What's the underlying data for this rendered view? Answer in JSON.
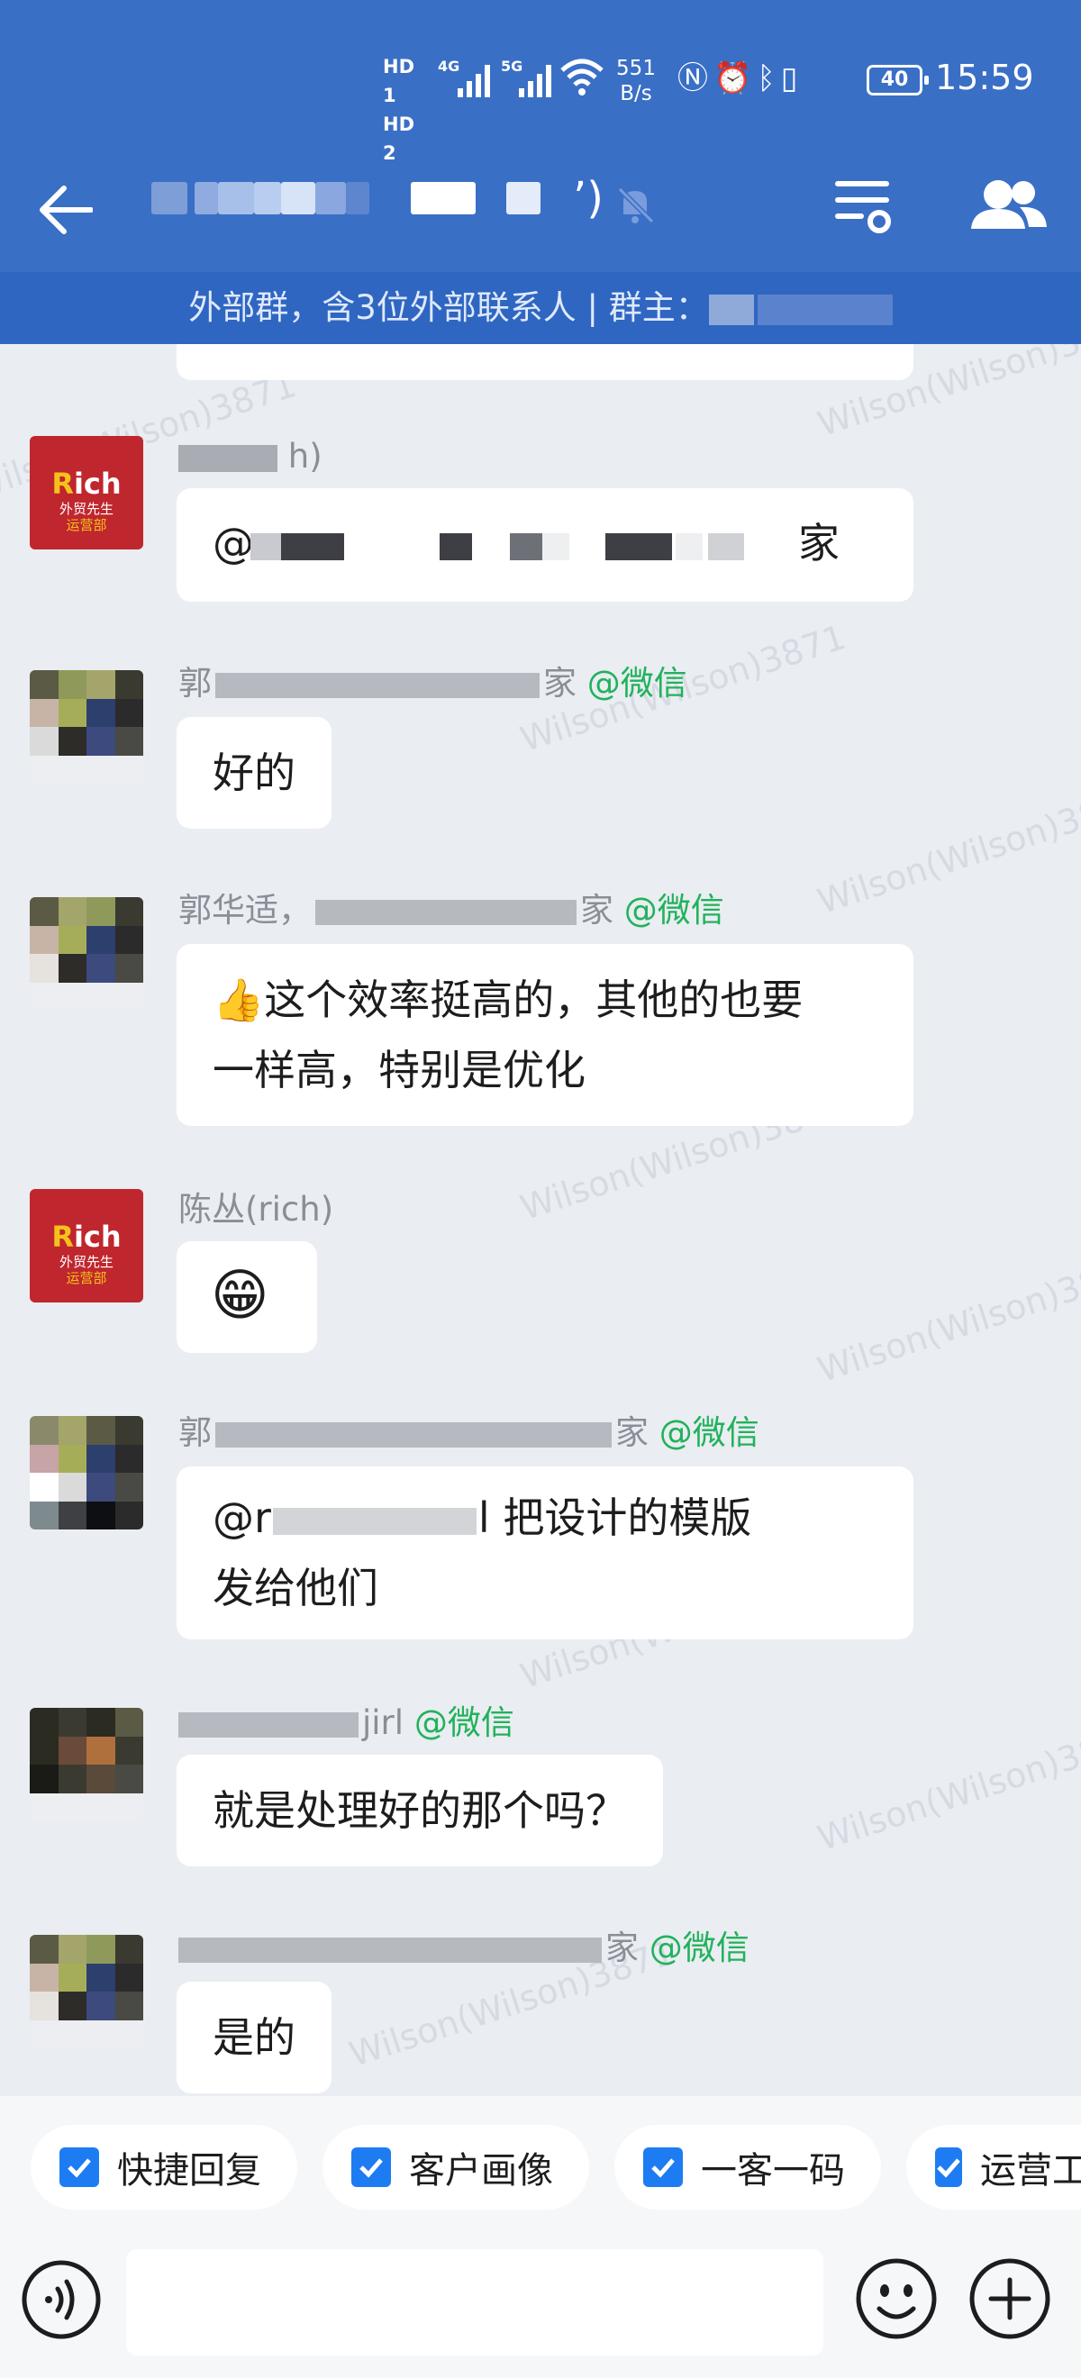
{
  "status_bar": {
    "hd1": "HD 1",
    "hd2": "HD 2",
    "net_4g": "4G",
    "net_5g": "5G",
    "speed_value": "551",
    "speed_unit": "B/s",
    "battery": "40",
    "time": "15:59"
  },
  "header": {
    "title_suffix": "’)",
    "accent_color": "#3a6fc6"
  },
  "notice": {
    "text": "外部群，含3位外部联系人 | 群主："
  },
  "messages": [
    {
      "sender_tail": "h)",
      "text": "@",
      "tail": "家"
    },
    {
      "sender_head": "郭",
      "sender_tail": "家",
      "channel": "@微信",
      "text": "好的"
    },
    {
      "sender_head": "郭华适，",
      "sender_tail": "家",
      "channel": "@微信",
      "text_line1": "这个效率挺高的，其他的也要",
      "text_line2": "一样高，特别是优化"
    },
    {
      "sender": "陈丛(rich)",
      "emoji": "😁"
    },
    {
      "sender_head": "郭",
      "sender_tail": "家",
      "channel": "@微信",
      "text_line1": "@r",
      "text_line1_b": "l 把设计的模版",
      "text_line2": "发给他们"
    },
    {
      "sender_tail": "jirl",
      "channel": "@微信",
      "text": "就是处理好的那个吗？"
    },
    {
      "sender_tail": "家",
      "channel": "@微信",
      "text": "是的"
    }
  ],
  "avatar_rich": {
    "line1a": "R",
    "line1b": "ich",
    "line2": "外贸先生",
    "line3": "运营部"
  },
  "watermark": "Wilson(Wilson)3871",
  "quick_actions": [
    "快捷回复",
    "客户画像",
    "一客一码",
    "运营工"
  ],
  "colors": {
    "wechat_tag": "#21b25b",
    "check": "#1d7cf2",
    "rich_red": "#c0262d"
  }
}
